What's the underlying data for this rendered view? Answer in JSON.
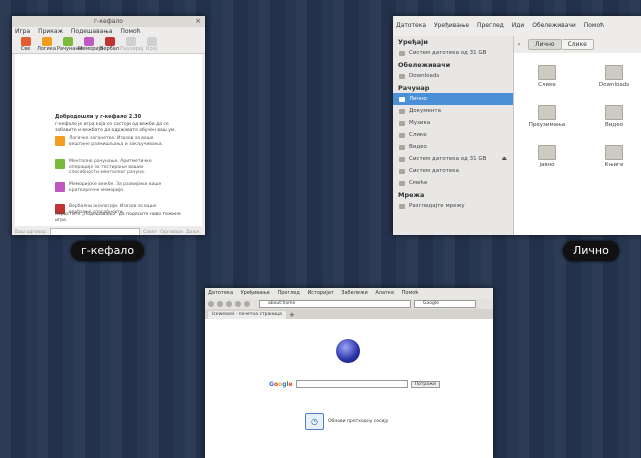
{
  "game_window": {
    "title": "г-кефало",
    "caption": "г-кефало",
    "menu": [
      "Игра",
      "Прикаж",
      "Подешавања",
      "Помоћ"
    ],
    "toolbar": [
      {
        "label": "Све",
        "icon": "puzzle-icon",
        "color": "#e25d2f",
        "enabled": true
      },
      {
        "label": "Логика",
        "icon": "logic-icon",
        "color": "#f49c1c",
        "enabled": true
      },
      {
        "label": "Рачунање",
        "icon": "calculation-icon",
        "color": "#7bba3d",
        "enabled": true
      },
      {
        "label": "Меморија",
        "icon": "memory-icon",
        "color": "#c058c1",
        "enabled": true
      },
      {
        "label": "Вербал",
        "icon": "verbal-icon",
        "color": "#c03434",
        "enabled": true
      },
      {
        "label": "Паузирај",
        "icon": "pause-icon",
        "color": "#bdbdbd",
        "enabled": false
      },
      {
        "label": "Крај",
        "icon": "stop-icon",
        "color": "#bdbdbd",
        "enabled": false
      }
    ],
    "welcome_heading": "Добродошли у г-кефало 2.30",
    "welcome_intro": "г-кефало је игра која се састоји од вежби да се забавите и вежбате да одржавате обучен ваш ум.",
    "categories": [
      {
        "text": "Логичке загонетке. Изазов за ваше вештине размишљања и закључивања.",
        "color": "#f49c1c"
      },
      {
        "text": "Ментално рачунање. Аритметичке операције за тестирање ваших способности менталног рачуна.",
        "color": "#7bba3d"
      },
      {
        "text": "Меморијске вежбе. За развијање ваше краткорочне меморије.",
        "color": "#c058c1"
      },
      {
        "text": "Вербални аналогији. Изазов за ваше вербалне способности.",
        "color": "#c03434"
      }
    ],
    "footer_hint": "Користите „Подешавања“ да подесите ниво тежине игре.",
    "bottom_bar": {
      "answer_placeholder": "Ваш одговор:",
      "tip_label": "Савет",
      "answer_label": "Одговори",
      "next_label": "Даље"
    }
  },
  "files_window": {
    "caption": "Лично",
    "menu": [
      "Датотека",
      "Уређивање",
      "Преглед",
      "Иди",
      "Обележивачи",
      "Помоћ"
    ],
    "sidebar": [
      {
        "type": "heading",
        "label": "Уређаји"
      },
      {
        "type": "item",
        "label": "Систем датотека од 31 GB",
        "eject": false
      },
      {
        "type": "heading",
        "label": "Обележивачи"
      },
      {
        "type": "item",
        "label": "Downloads",
        "eject": false
      },
      {
        "type": "heading",
        "label": "Рачунар"
      },
      {
        "type": "item",
        "label": "Лично",
        "selected": true
      },
      {
        "type": "item",
        "label": "Документа"
      },
      {
        "type": "item",
        "label": "Музика"
      },
      {
        "type": "item",
        "label": "Слике"
      },
      {
        "type": "item",
        "label": "Видео"
      },
      {
        "type": "item",
        "label": "Систем датотека од 31 GB",
        "eject": true
      },
      {
        "type": "item",
        "label": "Систем датотека"
      },
      {
        "type": "item",
        "label": "Смеће"
      },
      {
        "type": "heading",
        "label": "Мрежа"
      },
      {
        "type": "item",
        "label": "Разгледајте мрежу"
      }
    ],
    "path": {
      "back_icon": "chevron-left-icon",
      "current": "Лично",
      "next": "Слике"
    },
    "items": [
      "Слике",
      "Downloads",
      "Преузимања",
      "Видео",
      "јавно",
      "Књиге"
    ]
  },
  "browser_window": {
    "menu": [
      "Датотека",
      "Уређивање",
      "Преглед",
      "Историјат",
      "Забележи",
      "Алатке",
      "Помоћ"
    ],
    "url": "about:home",
    "search_engine": "Google",
    "tab_title": "Iceweasel - почетна страница",
    "search_button": "Потражи",
    "link_label": "Обнови претходну сесију"
  },
  "accent": "#4a90d9"
}
